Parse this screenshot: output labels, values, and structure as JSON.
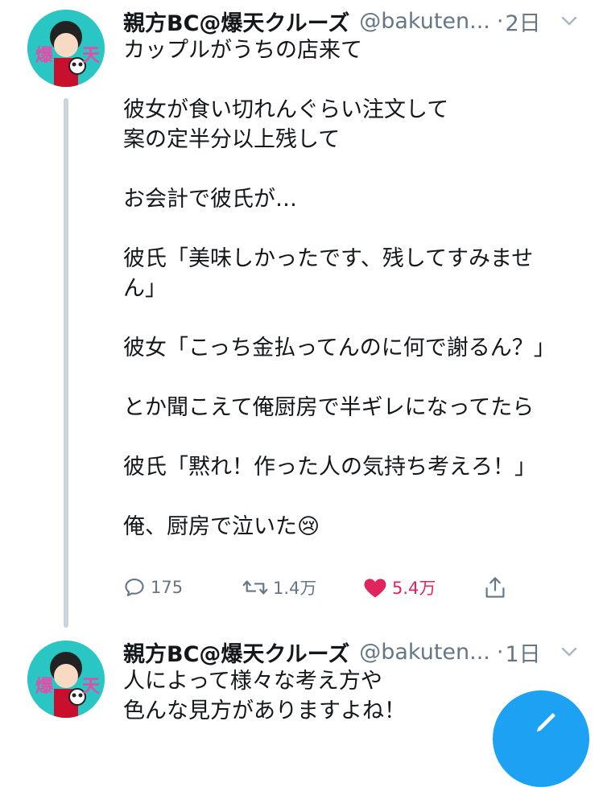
{
  "tweets": [
    {
      "display_name": "親方BC@爆天クルーズ",
      "handle": "@bakuten...",
      "separator": "·",
      "time": "2日",
      "text": "カップルがうちの店来て\n\n彼女が食い切れんぐらい注文して\n案の定半分以上残して\n\nお会計で彼氏が…\n\n彼氏「美味しかったです、残してすみませ\nん」\n\n彼女「こっち金払ってんのに何で謝るん？」\n\nとか聞こえて俺厨房で半ギレになってたら\n\n彼氏「黙れ！作った人の気持ち考えろ！」\n\n俺、厨房で泣いた",
      "emoji": "😢",
      "actions": {
        "reply_count": "175",
        "retweet_count": "1.4万",
        "like_count": "5.4万",
        "liked": true
      },
      "avatar_text": "爆天"
    },
    {
      "display_name": "親方BC@爆天クルーズ",
      "handle": "@bakuten...",
      "separator": "·",
      "time": "1日",
      "text": "人によって様々な考え方や\n色んな見方がありますよね！",
      "avatar_text": "爆天"
    }
  ],
  "colors": {
    "text_primary": "#14171a",
    "text_secondary": "#657786",
    "like_active": "#e0245e",
    "thread_line": "#c9d4dd",
    "fab": "#1da1f2",
    "avatar_bg": "#29c6c4"
  },
  "icons": [
    "reply-icon",
    "retweet-icon",
    "heart-icon",
    "share-icon",
    "chevron-down-icon",
    "compose-icon"
  ]
}
